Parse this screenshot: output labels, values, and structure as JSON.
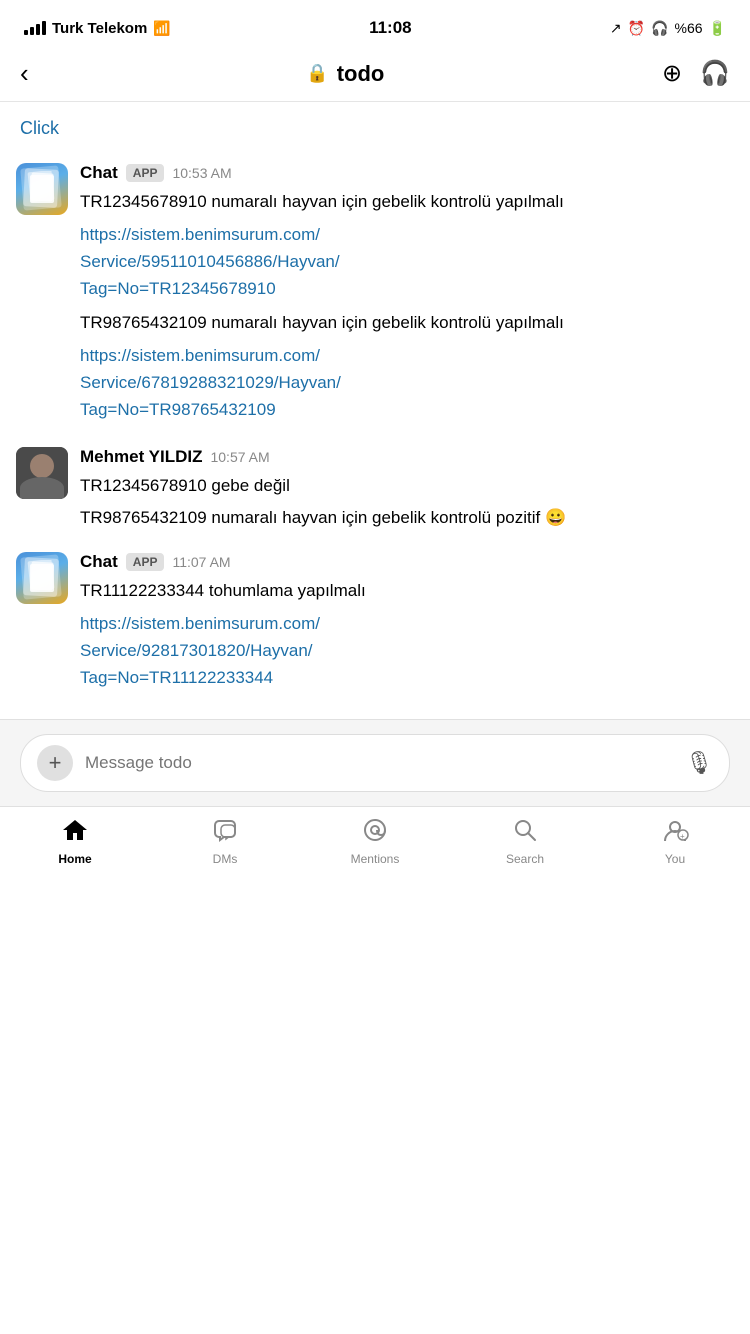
{
  "statusBar": {
    "carrier": "Turk Telekom",
    "time": "11:08",
    "battery": "%66"
  },
  "navBar": {
    "title": "todo",
    "backLabel": "‹"
  },
  "chat": {
    "clickLink": "Click",
    "messages": [
      {
        "id": "msg1",
        "sender": "Chat",
        "badge": "APP",
        "timestamp": "10:53 AM",
        "type": "app",
        "blocks": [
          {
            "type": "text",
            "content": "TR12345678910 numaralı hayvan için gebelik kontrolü yapılmalı"
          },
          {
            "type": "link",
            "content": "https://sistem.benimsurum.com/\nService/59511010456886/Hayvan/\nTag=No=TR12345678910",
            "href": "https://sistem.benimsurum.com/Service/59511010456886/Hayvan/Tag=No=TR12345678910"
          },
          {
            "type": "text",
            "content": "TR98765432109 numaralı hayvan için gebelik kontrolü yapılmalı"
          },
          {
            "type": "link",
            "content": "https://sistem.benimsurum.com/\nService/67819288321029/Hayvan/\nTag=No=TR98765432109",
            "href": "https://sistem.benimsurum.com/Service/67819288321029/Hayvan/Tag=No=TR98765432109"
          }
        ]
      },
      {
        "id": "msg2",
        "sender": "Mehmet YILDIZ",
        "timestamp": "10:57 AM",
        "type": "person",
        "blocks": [
          {
            "type": "text",
            "content": "TR12345678910 gebe değil"
          },
          {
            "type": "text",
            "content": "TR98765432109 numaralı hayvan için gebelik kontrolü pozitif 😀"
          }
        ]
      },
      {
        "id": "msg3",
        "sender": "Chat",
        "badge": "APP",
        "timestamp": "11:07 AM",
        "type": "app",
        "blocks": [
          {
            "type": "text",
            "content": "TR11122233344 tohumlama yapılmalı"
          },
          {
            "type": "link",
            "content": "https://sistem.benimsurum.com/\nService/92817301820/Hayvan/\nTag=No=TR11122233344",
            "href": "https://sistem.benimsurum.com/Service/92817301820/Hayvan/Tag=No=TR11122233344"
          }
        ]
      }
    ]
  },
  "inputBar": {
    "placeholder": "Message todo"
  },
  "bottomNav": {
    "items": [
      {
        "id": "home",
        "label": "Home",
        "icon": "home",
        "active": true
      },
      {
        "id": "dms",
        "label": "DMs",
        "icon": "dms",
        "active": false
      },
      {
        "id": "mentions",
        "label": "Mentions",
        "icon": "at",
        "active": false
      },
      {
        "id": "search",
        "label": "Search",
        "icon": "search",
        "active": false
      },
      {
        "id": "you",
        "label": "You",
        "icon": "you",
        "active": false
      }
    ]
  }
}
